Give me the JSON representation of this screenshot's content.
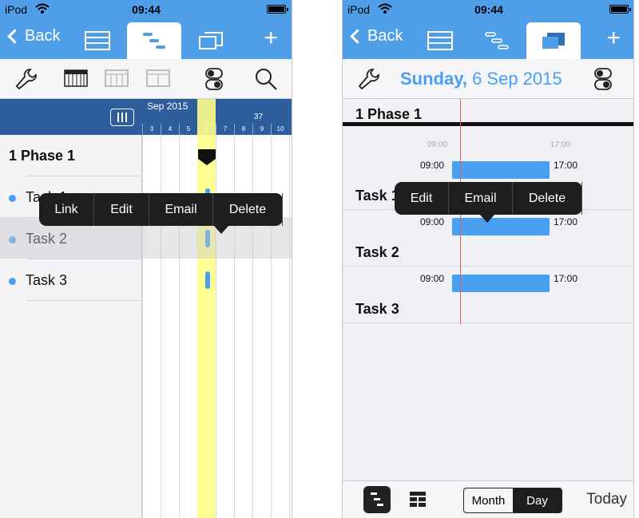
{
  "status": {
    "carrier": "iPod",
    "time": "09:44"
  },
  "nav": {
    "back_label": "Back"
  },
  "left": {
    "timeline": {
      "month": "Sep 2015",
      "week": "37",
      "days": [
        "3",
        "4",
        "5",
        "6",
        "7",
        "8",
        "9",
        "10"
      ]
    },
    "phase": "1 Phase 1",
    "tasks": [
      "Task 1",
      "Task 2",
      "Task 3"
    ],
    "popup": [
      "Link",
      "Edit",
      "Email",
      "Delete"
    ]
  },
  "right": {
    "date_weekday": "Sunday,",
    "date_rest": " 6 Sep 2015",
    "phase": "1 Phase 1",
    "hint_start": "09:00",
    "hint_end": "17:00",
    "tasks": [
      {
        "name": "Task 1",
        "start": "09:00",
        "end": "17:00"
      },
      {
        "name": "Task 2",
        "start": "09:00",
        "end": "17:00"
      },
      {
        "name": "Task 3",
        "start": "09:00",
        "end": "17:00"
      }
    ],
    "popup": [
      "Edit",
      "Email",
      "Delete"
    ],
    "segment": [
      "Month",
      "Day"
    ],
    "today": "Today"
  },
  "colors": {
    "accent": "#4f9ee8",
    "header": "#2e5d9e",
    "bar": "#4aa0f0",
    "today_column": "#ffff88"
  }
}
